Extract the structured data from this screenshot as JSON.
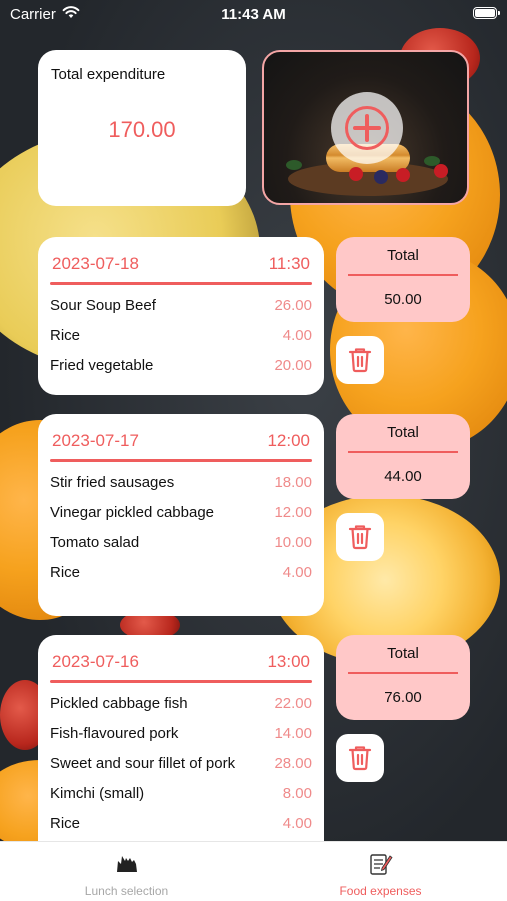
{
  "status_bar": {
    "carrier": "Carrier",
    "time": "11:43 AM",
    "wifi_icon": "wifi-icon",
    "battery_icon": "battery-icon"
  },
  "summary": {
    "label": "Total expenditure",
    "amount": "170.00"
  },
  "photo_card": {
    "icon": "add-circle-icon"
  },
  "records": [
    {
      "date": "2023-07-18",
      "time": "11:30",
      "items": [
        {
          "name": "Sour Soup Beef",
          "price": "26.00"
        },
        {
          "name": "Rice",
          "price": "4.00"
        },
        {
          "name": "Fried vegetable",
          "price": "20.00"
        }
      ],
      "total_label": "Total",
      "total": "50.00"
    },
    {
      "date": "2023-07-17",
      "time": "12:00",
      "items": [
        {
          "name": "Stir fried sausages",
          "price": "18.00"
        },
        {
          "name": "Vinegar pickled cabbage",
          "price": "12.00"
        },
        {
          "name": "Tomato salad",
          "price": "10.00"
        },
        {
          "name": "Rice",
          "price": "4.00"
        }
      ],
      "total_label": "Total",
      "total": "44.00"
    },
    {
      "date": "2023-07-16",
      "time": "13:00",
      "items": [
        {
          "name": "Pickled cabbage fish",
          "price": "22.00"
        },
        {
          "name": "Fish-flavoured pork",
          "price": "14.00"
        },
        {
          "name": "Sweet and sour fillet of pork",
          "price": "28.00"
        },
        {
          "name": "Kimchi (small)",
          "price": "8.00"
        },
        {
          "name": "Rice",
          "price": "4.00"
        }
      ],
      "total_label": "Total",
      "total": "76.00"
    }
  ],
  "tab_bar": {
    "tabs": [
      {
        "label": "Lunch selection",
        "icon": "cooking-pot-icon",
        "active": false
      },
      {
        "label": "Food expenses",
        "icon": "receipt-pen-icon",
        "active": true
      }
    ]
  },
  "colors": {
    "accent": "#ef5d5d",
    "price_text": "#ef8a8a",
    "total_box": "#ffc8c8",
    "inactive_tab": "#a7a7a7"
  }
}
